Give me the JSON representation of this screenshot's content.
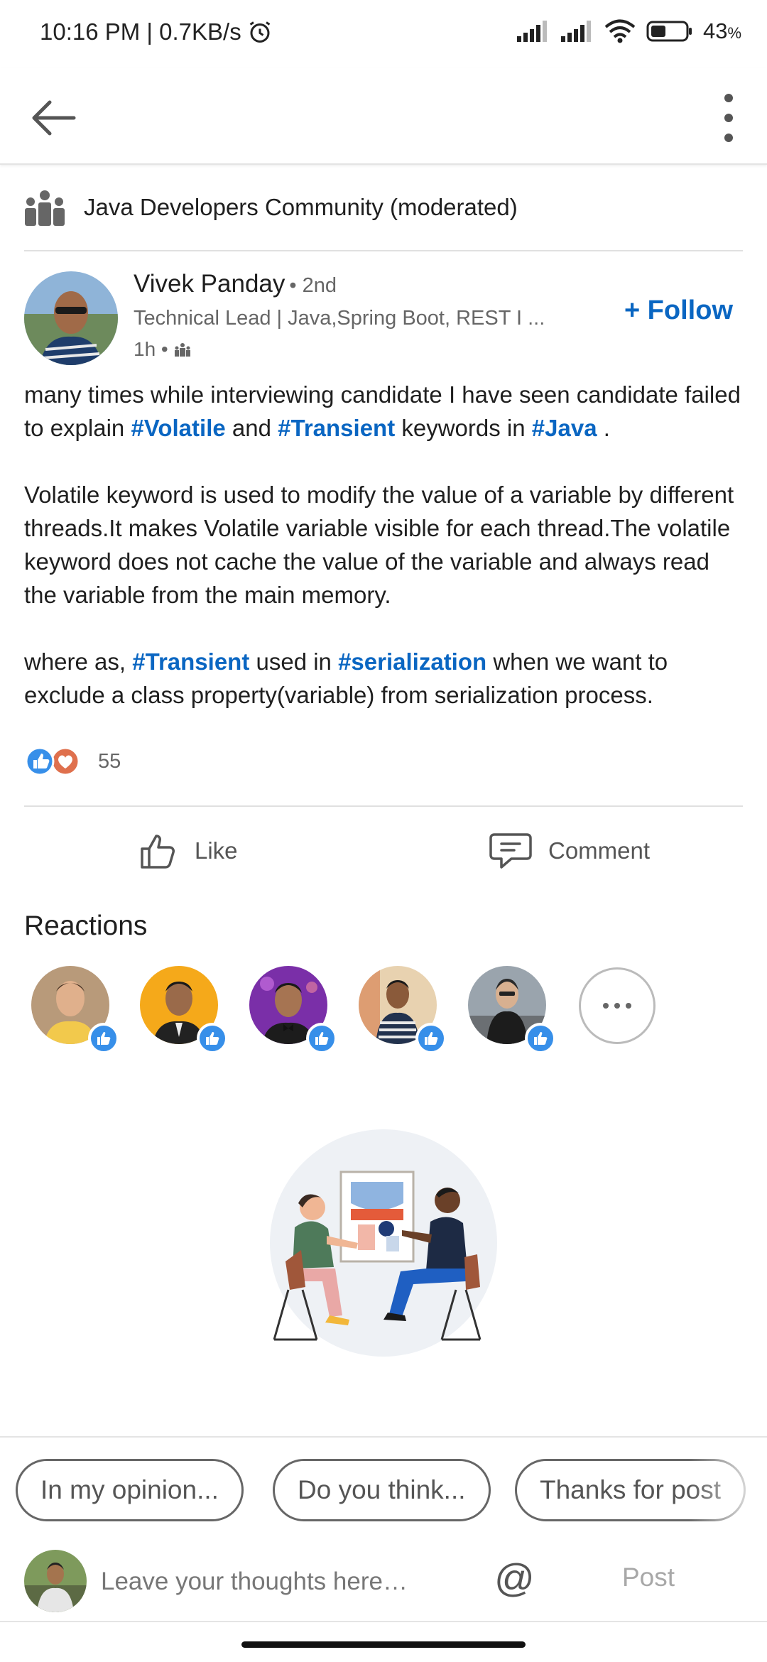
{
  "status_bar": {
    "time_speed": "10:16 PM | 0.7KB/s",
    "battery_pct": "43",
    "battery_sign": "%",
    "battery_level": 0.43
  },
  "topbar": {
    "back_icon": "arrow-left-icon",
    "more_icon": "more-vertical-icon"
  },
  "group": {
    "icon": "group-icon",
    "name": "Java Developers Community (moderated)"
  },
  "author": {
    "name": "Vivek Panday",
    "degree": "• 2nd",
    "headline": "Technical Lead | Java,Spring Boot, REST I ...",
    "time": "1h •",
    "follow_label": "+ Follow"
  },
  "post": {
    "p1_a": "many times while interviewing candidate I have seen candidate failed to explain ",
    "tag_volatile": "#Volatile",
    "p1_b": " and ",
    "tag_transient": "#Transient",
    "p1_c": " keywords in ",
    "tag_java": "#Java",
    "p1_d": " .",
    "p2": "Volatile keyword is used to modify the value of a variable by different threads.It makes Volatile variable visible for each thread.The volatile keyword does not cache the value of the variable and always read the variable from the main memory.",
    "p3_a": "where as, ",
    "tag_transient2": "#Transient",
    "p3_b": " used in ",
    "tag_serialization": "#serialization",
    "p3_c": " when we want to exclude a class property(variable) from serialization process."
  },
  "reactions_summary": {
    "count": "55",
    "icons": [
      "like-icon",
      "love-icon"
    ]
  },
  "actions": {
    "like_label": "Like",
    "comment_label": "Comment"
  },
  "reactions_section": {
    "title": "Reactions",
    "reactors": [
      {
        "avatar": "avatar-1",
        "reaction": "like-icon"
      },
      {
        "avatar": "avatar-2",
        "reaction": "like-icon"
      },
      {
        "avatar": "avatar-3",
        "reaction": "like-icon"
      },
      {
        "avatar": "avatar-4",
        "reaction": "like-icon"
      },
      {
        "avatar": "avatar-5",
        "reaction": "like-icon"
      }
    ],
    "more_icon": "more-horizontal-icon"
  },
  "suggestions": [
    "In my opinion...",
    "Do you think...",
    "Thanks for post"
  ],
  "composer": {
    "placeholder": "Leave your thoughts here…",
    "mention_label": "@",
    "post_label": "Post"
  },
  "colors": {
    "link": "#0a66c2",
    "like_badge": "#378fe9",
    "love_badge": "#df704d"
  }
}
